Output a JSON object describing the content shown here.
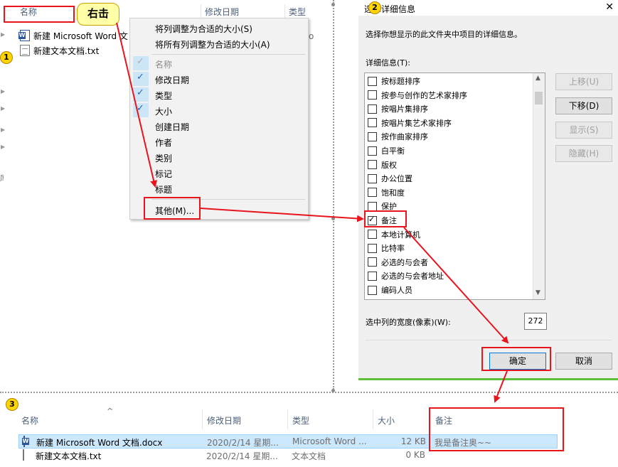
{
  "panel1": {
    "col_name": "名称",
    "col_modified": "修改日期",
    "col_type": "类型",
    "files": [
      {
        "icon": "word-doc-icon",
        "name": "新建 Microsoft Word 文"
      },
      {
        "icon": "text-file-icon",
        "name": "新建文本文档.txt"
      }
    ],
    "partial_type_text": "o",
    "left_edge_char": "库"
  },
  "callout": {
    "label": "右击"
  },
  "steps": {
    "one": "1",
    "two": "2",
    "three": "3"
  },
  "context_menu": {
    "items": [
      {
        "label": "将列调整为合适的大小(S)",
        "checked": false,
        "disabled": false
      },
      {
        "label": "将所有列调整为合适的大小(A)",
        "checked": false,
        "disabled": false
      },
      {
        "label": "名称",
        "checked": true,
        "disabled": true
      },
      {
        "label": "修改日期",
        "checked": true,
        "disabled": false
      },
      {
        "label": "类型",
        "checked": true,
        "disabled": false
      },
      {
        "label": "大小",
        "checked": true,
        "disabled": false
      },
      {
        "label": "创建日期",
        "checked": false,
        "disabled": false
      },
      {
        "label": "作者",
        "checked": false,
        "disabled": false
      },
      {
        "label": "类别",
        "checked": false,
        "disabled": false
      },
      {
        "label": "标记",
        "checked": false,
        "disabled": false
      },
      {
        "label": "标题",
        "checked": false,
        "disabled": false
      },
      {
        "label": "其他(M)...",
        "checked": false,
        "disabled": false
      }
    ]
  },
  "dialog": {
    "title": "选择详细信息",
    "close_glyph": "✕",
    "instruction": "选择你想显示的此文件夹中项目的详细信息。",
    "details_label": "详细信息(T):",
    "items": [
      {
        "label": "按标题排序",
        "checked": false
      },
      {
        "label": "按参与创作的艺术家排序",
        "checked": false
      },
      {
        "label": "按唱片集排序",
        "checked": false
      },
      {
        "label": "按唱片集艺术家排序",
        "checked": false
      },
      {
        "label": "按作曲家排序",
        "checked": false
      },
      {
        "label": "白平衡",
        "checked": false
      },
      {
        "label": "版权",
        "checked": false
      },
      {
        "label": "办公位置",
        "checked": false
      },
      {
        "label": "饱和度",
        "checked": false
      },
      {
        "label": "保护",
        "checked": false
      },
      {
        "label": "备注",
        "checked": true
      },
      {
        "label": "本地计算机",
        "checked": false
      },
      {
        "label": "比特率",
        "checked": false
      },
      {
        "label": "必选的与会者",
        "checked": false
      },
      {
        "label": "必选的与会者地址",
        "checked": false
      },
      {
        "label": "编码人员",
        "checked": false
      }
    ],
    "btn_up": "上移(U)",
    "btn_down": "下移(D)",
    "btn_show": "显示(S)",
    "btn_hide": "隐藏(H)",
    "width_label": "选中列的宽度(像素)(W):",
    "width_value": "272",
    "ok": "确定",
    "cancel": "取消"
  },
  "panel3": {
    "headers": {
      "name": "名称",
      "modified": "修改日期",
      "type": "类型",
      "size": "大小",
      "note": "备注"
    },
    "sort_glyph": "^",
    "rows": [
      {
        "icon": "word-doc-icon",
        "name": "新建 Microsoft Word 文档.docx",
        "modified": "2020/2/14 星期...",
        "type": "Microsoft Word ...",
        "size": "12 KB",
        "note": "我是备注奥~~",
        "selected": true
      },
      {
        "icon": "text-file-icon",
        "name": "新建文本文档.txt",
        "modified": "2020/2/14 星期...",
        "type": "文本文档",
        "size": "0 KB",
        "note": "",
        "selected": false
      }
    ]
  },
  "colors": {
    "annotation_red": "#e8141e",
    "callout_yellow": "#ffffa8",
    "selection_blue": "#cce8ff",
    "accent_green": "#5fbf3a"
  }
}
